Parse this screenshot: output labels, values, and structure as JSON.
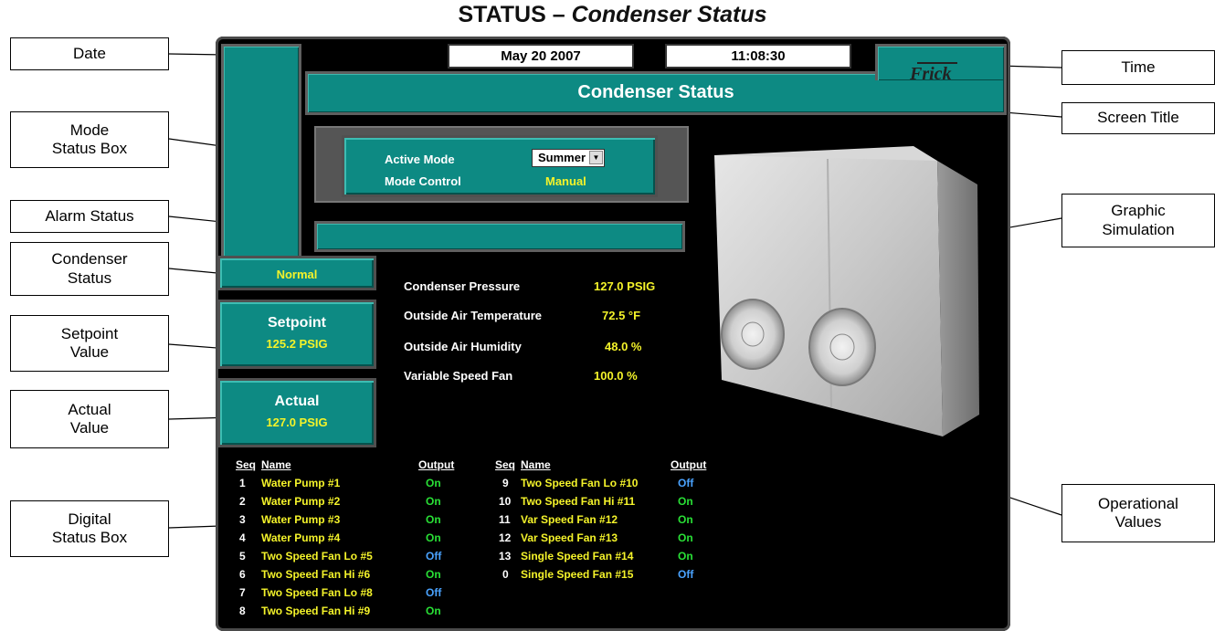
{
  "heading": {
    "main": "STATUS – ",
    "sub": "Condenser Status"
  },
  "callouts": {
    "date": "Date",
    "time": "Time",
    "screen_title": "Screen Title",
    "mode_status_box_1": "Mode",
    "mode_status_box_2": "Status Box",
    "alarm_status": "Alarm Status",
    "condenser_status_1": "Condenser",
    "condenser_status_2": "Status",
    "setpoint_value_1": "Setpoint",
    "setpoint_value_2": "Value",
    "actual_value_1": "Actual",
    "actual_value_2": "Value",
    "digital_status_box_1": "Digital",
    "digital_status_box_2": "Status Box",
    "graphic_simulation_1": "Graphic",
    "graphic_simulation_2": "Simulation",
    "operational_values_1": "Operational",
    "operational_values_2": "Values"
  },
  "screen": {
    "date": "May 20 2007",
    "time": "11:08:30",
    "logo": "Frick",
    "title": "Condenser Status",
    "mode": {
      "active_mode_label": "Active Mode",
      "active_mode_value": "Summer",
      "mode_control_label": "Mode Control",
      "mode_control_value": "Manual"
    },
    "condenser_status": "Normal",
    "setpoint": {
      "label": "Setpoint",
      "value": "125.2 PSIG"
    },
    "actual": {
      "label": "Actual",
      "value": "127.0 PSIG"
    },
    "operational": [
      {
        "label": "Condenser Pressure",
        "value": "127.0 PSIG"
      },
      {
        "label": "Outside Air Temperature",
        "value": "72.5 °F"
      },
      {
        "label": "Outside Air Humidity",
        "value": "48.0 %"
      },
      {
        "label": "Variable Speed Fan",
        "value": "100.0 %"
      }
    ],
    "digital": {
      "headers": {
        "seq": "Seq",
        "name": "Name",
        "output": "Output"
      },
      "left": [
        {
          "seq": "1",
          "name": "Water Pump #1",
          "output": "On"
        },
        {
          "seq": "2",
          "name": "Water Pump #2",
          "output": "On"
        },
        {
          "seq": "3",
          "name": "Water Pump #3",
          "output": "On"
        },
        {
          "seq": "4",
          "name": "Water Pump #4",
          "output": "On"
        },
        {
          "seq": "5",
          "name": "Two Speed Fan Lo #5",
          "output": "Off"
        },
        {
          "seq": "6",
          "name": "Two Speed Fan Hi #6",
          "output": "On"
        },
        {
          "seq": "7",
          "name": "Two Speed Fan Lo #8",
          "output": "Off"
        },
        {
          "seq": "8",
          "name": "Two Speed Fan Hi #9",
          "output": "On"
        }
      ],
      "right": [
        {
          "seq": "9",
          "name": "Two Speed Fan Lo #10",
          "output": "Off"
        },
        {
          "seq": "10",
          "name": "Two Speed Fan Hi #11",
          "output": "On"
        },
        {
          "seq": "11",
          "name": "Var Speed Fan #12",
          "output": "On"
        },
        {
          "seq": "12",
          "name": "Var Speed Fan #13",
          "output": "On"
        },
        {
          "seq": "13",
          "name": "Single Speed Fan #14",
          "output": "On"
        },
        {
          "seq": "0",
          "name": "Single Speed Fan #15",
          "output": "Off"
        }
      ]
    }
  },
  "colors": {
    "teal": "#0d8a83",
    "on": "#29e036",
    "off": "#4aa3ff",
    "value": "#f4f32a"
  }
}
